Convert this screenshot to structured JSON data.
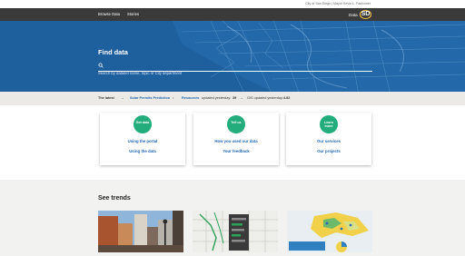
{
  "gov_bar": {
    "text": "City of San Diego | Mayor Kevin L. Faulconer"
  },
  "nav": {
    "browse": "Browse Data",
    "stories": "Stories"
  },
  "brand": {
    "text": "Data",
    "badge": "SD"
  },
  "hero": {
    "title": "Find data",
    "search_placeholder": "Search by dataset name, topic or City department"
  },
  "latest": {
    "label": "The latest",
    "item1": "Solar Permits Prediction",
    "item2_link": "Resources",
    "item2_text": "updated yesterday:",
    "item2_value": "39",
    "item3_text": "GIS updated yesterday:",
    "item3_value": "4.82"
  },
  "cards": [
    {
      "icon_text": "Get data",
      "icon_name": "get-data-icon",
      "link1": "Using the portal",
      "link2": "Using the data"
    },
    {
      "icon_text": "Tell us",
      "icon_name": "tell-us-icon",
      "link1": "How you used our data",
      "link2": "Your feedback"
    },
    {
      "icon_text": "Learn more",
      "icon_name": "learn-more-icon",
      "link1": "Our services",
      "link2": "Our projects"
    }
  ],
  "trends": {
    "heading": "See trends"
  },
  "colors": {
    "hero": "#1e5f9e",
    "accent_green": "#23ad7c",
    "link": "#1f66b3",
    "nav": "#3a3a3a"
  }
}
